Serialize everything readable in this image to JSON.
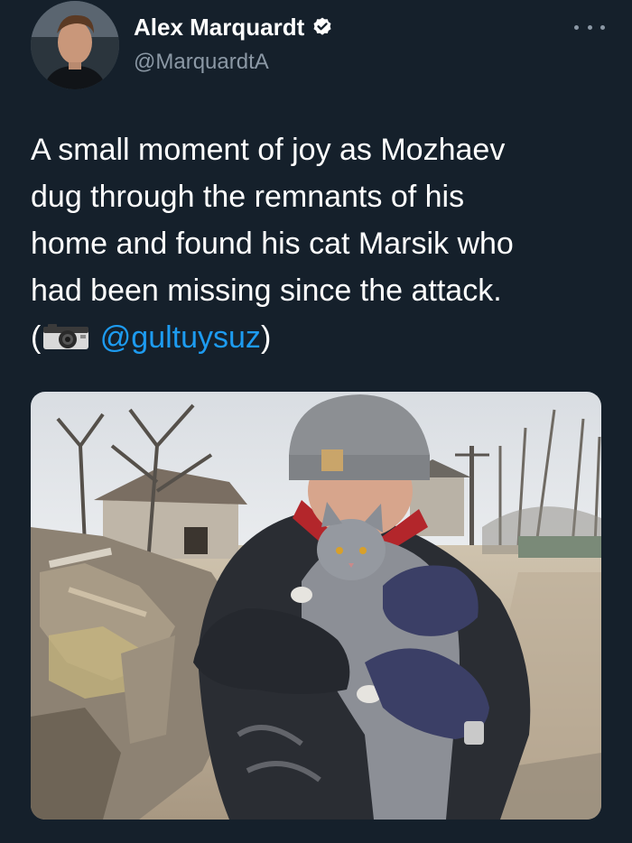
{
  "author": {
    "display_name": "Alex Marquardt",
    "handle": "@MarquardtA",
    "verified": true,
    "avatar_icon": "profile-photo"
  },
  "tweet": {
    "lines": [
      "A small moment of joy as Mozhaev",
      "dug through the remnants of his",
      "home and found his cat Marsik who",
      "had been missing since the attack."
    ],
    "credit_open": "(",
    "credit_icon": "camera-icon",
    "credit_mention": "@gultuysuz",
    "credit_close": ")"
  },
  "media": {
    "kind": "photo",
    "subject": "man in grey beanie holding grey cat amid rubble"
  },
  "colors": {
    "background": "#15202b",
    "text": "#ffffff",
    "secondary": "#8b98a5",
    "accent": "#1d9bf0"
  }
}
